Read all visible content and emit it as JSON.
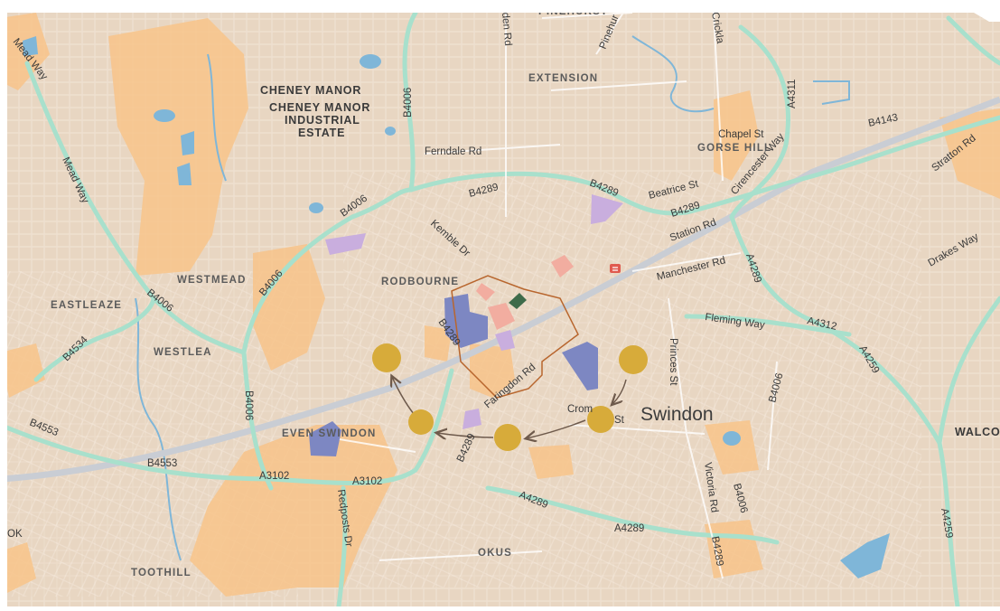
{
  "map": {
    "city_label": "Swindon",
    "districts": [
      {
        "id": "cheney-manor",
        "text": "CHENEY MANOR"
      },
      {
        "id": "cheney-manor-industrial-1",
        "text": "CHENEY MANOR"
      },
      {
        "id": "cheney-manor-industrial-2",
        "text": "INDUSTRIAL"
      },
      {
        "id": "cheney-manor-industrial-3",
        "text": "ESTATE"
      },
      {
        "id": "extension",
        "text": "EXTENSION"
      },
      {
        "id": "gorse-hill",
        "text": "GORSE HILL"
      },
      {
        "id": "westmead",
        "text": "WESTMEAD"
      },
      {
        "id": "rodbourne",
        "text": "RODBOURNE"
      },
      {
        "id": "eastleaze",
        "text": "EASTLEAZE"
      },
      {
        "id": "westlea",
        "text": "WESTLEA"
      },
      {
        "id": "even-swindon",
        "text": "EVEN SWINDON"
      },
      {
        "id": "toothill",
        "text": "TOOTHILL"
      },
      {
        "id": "okus",
        "text": "OKUS"
      },
      {
        "id": "walcot",
        "text": "WALCO"
      },
      {
        "id": "pinehurst",
        "text": "PINEHURST"
      }
    ],
    "roads": [
      {
        "id": "mead-way-1",
        "text": "Mead Way"
      },
      {
        "id": "mead-way-2",
        "text": "Mead Way"
      },
      {
        "id": "b4006-a",
        "text": "B4006"
      },
      {
        "id": "b4006-b",
        "text": "B4006"
      },
      {
        "id": "b4006-c",
        "text": "B4006"
      },
      {
        "id": "b4006-d",
        "text": "B4006"
      },
      {
        "id": "b4006-e",
        "text": "B4006"
      },
      {
        "id": "b4006-f",
        "text": "B4006"
      },
      {
        "id": "b4006-g",
        "text": "B4006"
      },
      {
        "id": "ferndale-rd",
        "text": "Ferndale Rd"
      },
      {
        "id": "b4289-a",
        "text": "B4289"
      },
      {
        "id": "b4289-b",
        "text": "B4289"
      },
      {
        "id": "b4289-c",
        "text": "B4289"
      },
      {
        "id": "b4289-d",
        "text": "B4289"
      },
      {
        "id": "b4289-e",
        "text": "B4289"
      },
      {
        "id": "b4289-f",
        "text": "B4289"
      },
      {
        "id": "chapel-st",
        "text": "Chapel St"
      },
      {
        "id": "a4311",
        "text": "A4311"
      },
      {
        "id": "b4143",
        "text": "B4143"
      },
      {
        "id": "cirencester-way",
        "text": "Cirencester Way"
      },
      {
        "id": "stratton-rd",
        "text": "Stratton Rd"
      },
      {
        "id": "beatrice-st",
        "text": "Beatrice St"
      },
      {
        "id": "station-rd",
        "text": "Station Rd"
      },
      {
        "id": "kemble-dr",
        "text": "Kemble Dr"
      },
      {
        "id": "manchester-rd",
        "text": "Manchester Rd"
      },
      {
        "id": "a4289-a",
        "text": "A4289"
      },
      {
        "id": "a4289-b",
        "text": "A4289"
      },
      {
        "id": "a4289-c",
        "text": "A4289"
      },
      {
        "id": "drakes-way",
        "text": "Drakes Way"
      },
      {
        "id": "fleming-way",
        "text": "Fleming Way"
      },
      {
        "id": "a4312",
        "text": "A4312"
      },
      {
        "id": "a4259-a",
        "text": "A4259"
      },
      {
        "id": "a4259-b",
        "text": "A4259"
      },
      {
        "id": "b4534",
        "text": "B4534"
      },
      {
        "id": "b4553-a",
        "text": "B4553"
      },
      {
        "id": "b4553-b",
        "text": "B4553"
      },
      {
        "id": "a3102-a",
        "text": "A3102"
      },
      {
        "id": "a3102-b",
        "text": "A3102"
      },
      {
        "id": "faringdon-rd",
        "text": "Faringdon Rd"
      },
      {
        "id": "princes-st",
        "text": "Princes St"
      },
      {
        "id": "cromb-st-1",
        "text": "Crom"
      },
      {
        "id": "cromb-st-2",
        "text": "St"
      },
      {
        "id": "victoria-rd",
        "text": "Victoria Rd"
      },
      {
        "id": "redposts-dr",
        "text": "Redposts Dr"
      },
      {
        "id": "cricklade",
        "text": "Crickla"
      },
      {
        "id": "pinehurst-rd",
        "text": "Pinehur"
      },
      {
        "id": "haydon-rd",
        "text": "den Rd"
      },
      {
        "id": "ok-edge",
        "text": "OK"
      }
    ]
  },
  "colors": {
    "land": "#e8d6c2",
    "urban_pattern": "#f6ece0",
    "parks": "#f8c48a",
    "water": "#7fb6d8",
    "major_road": "#a8e0cc",
    "rail": "#c9cdd4",
    "marker": "#d7ab3a",
    "arrow": "#6e5a4c",
    "outline": "#b8662e",
    "building_blue": "#7d87c2",
    "building_purple": "#c9aede",
    "building_pink": "#f2ada0"
  },
  "route_markers": 5
}
